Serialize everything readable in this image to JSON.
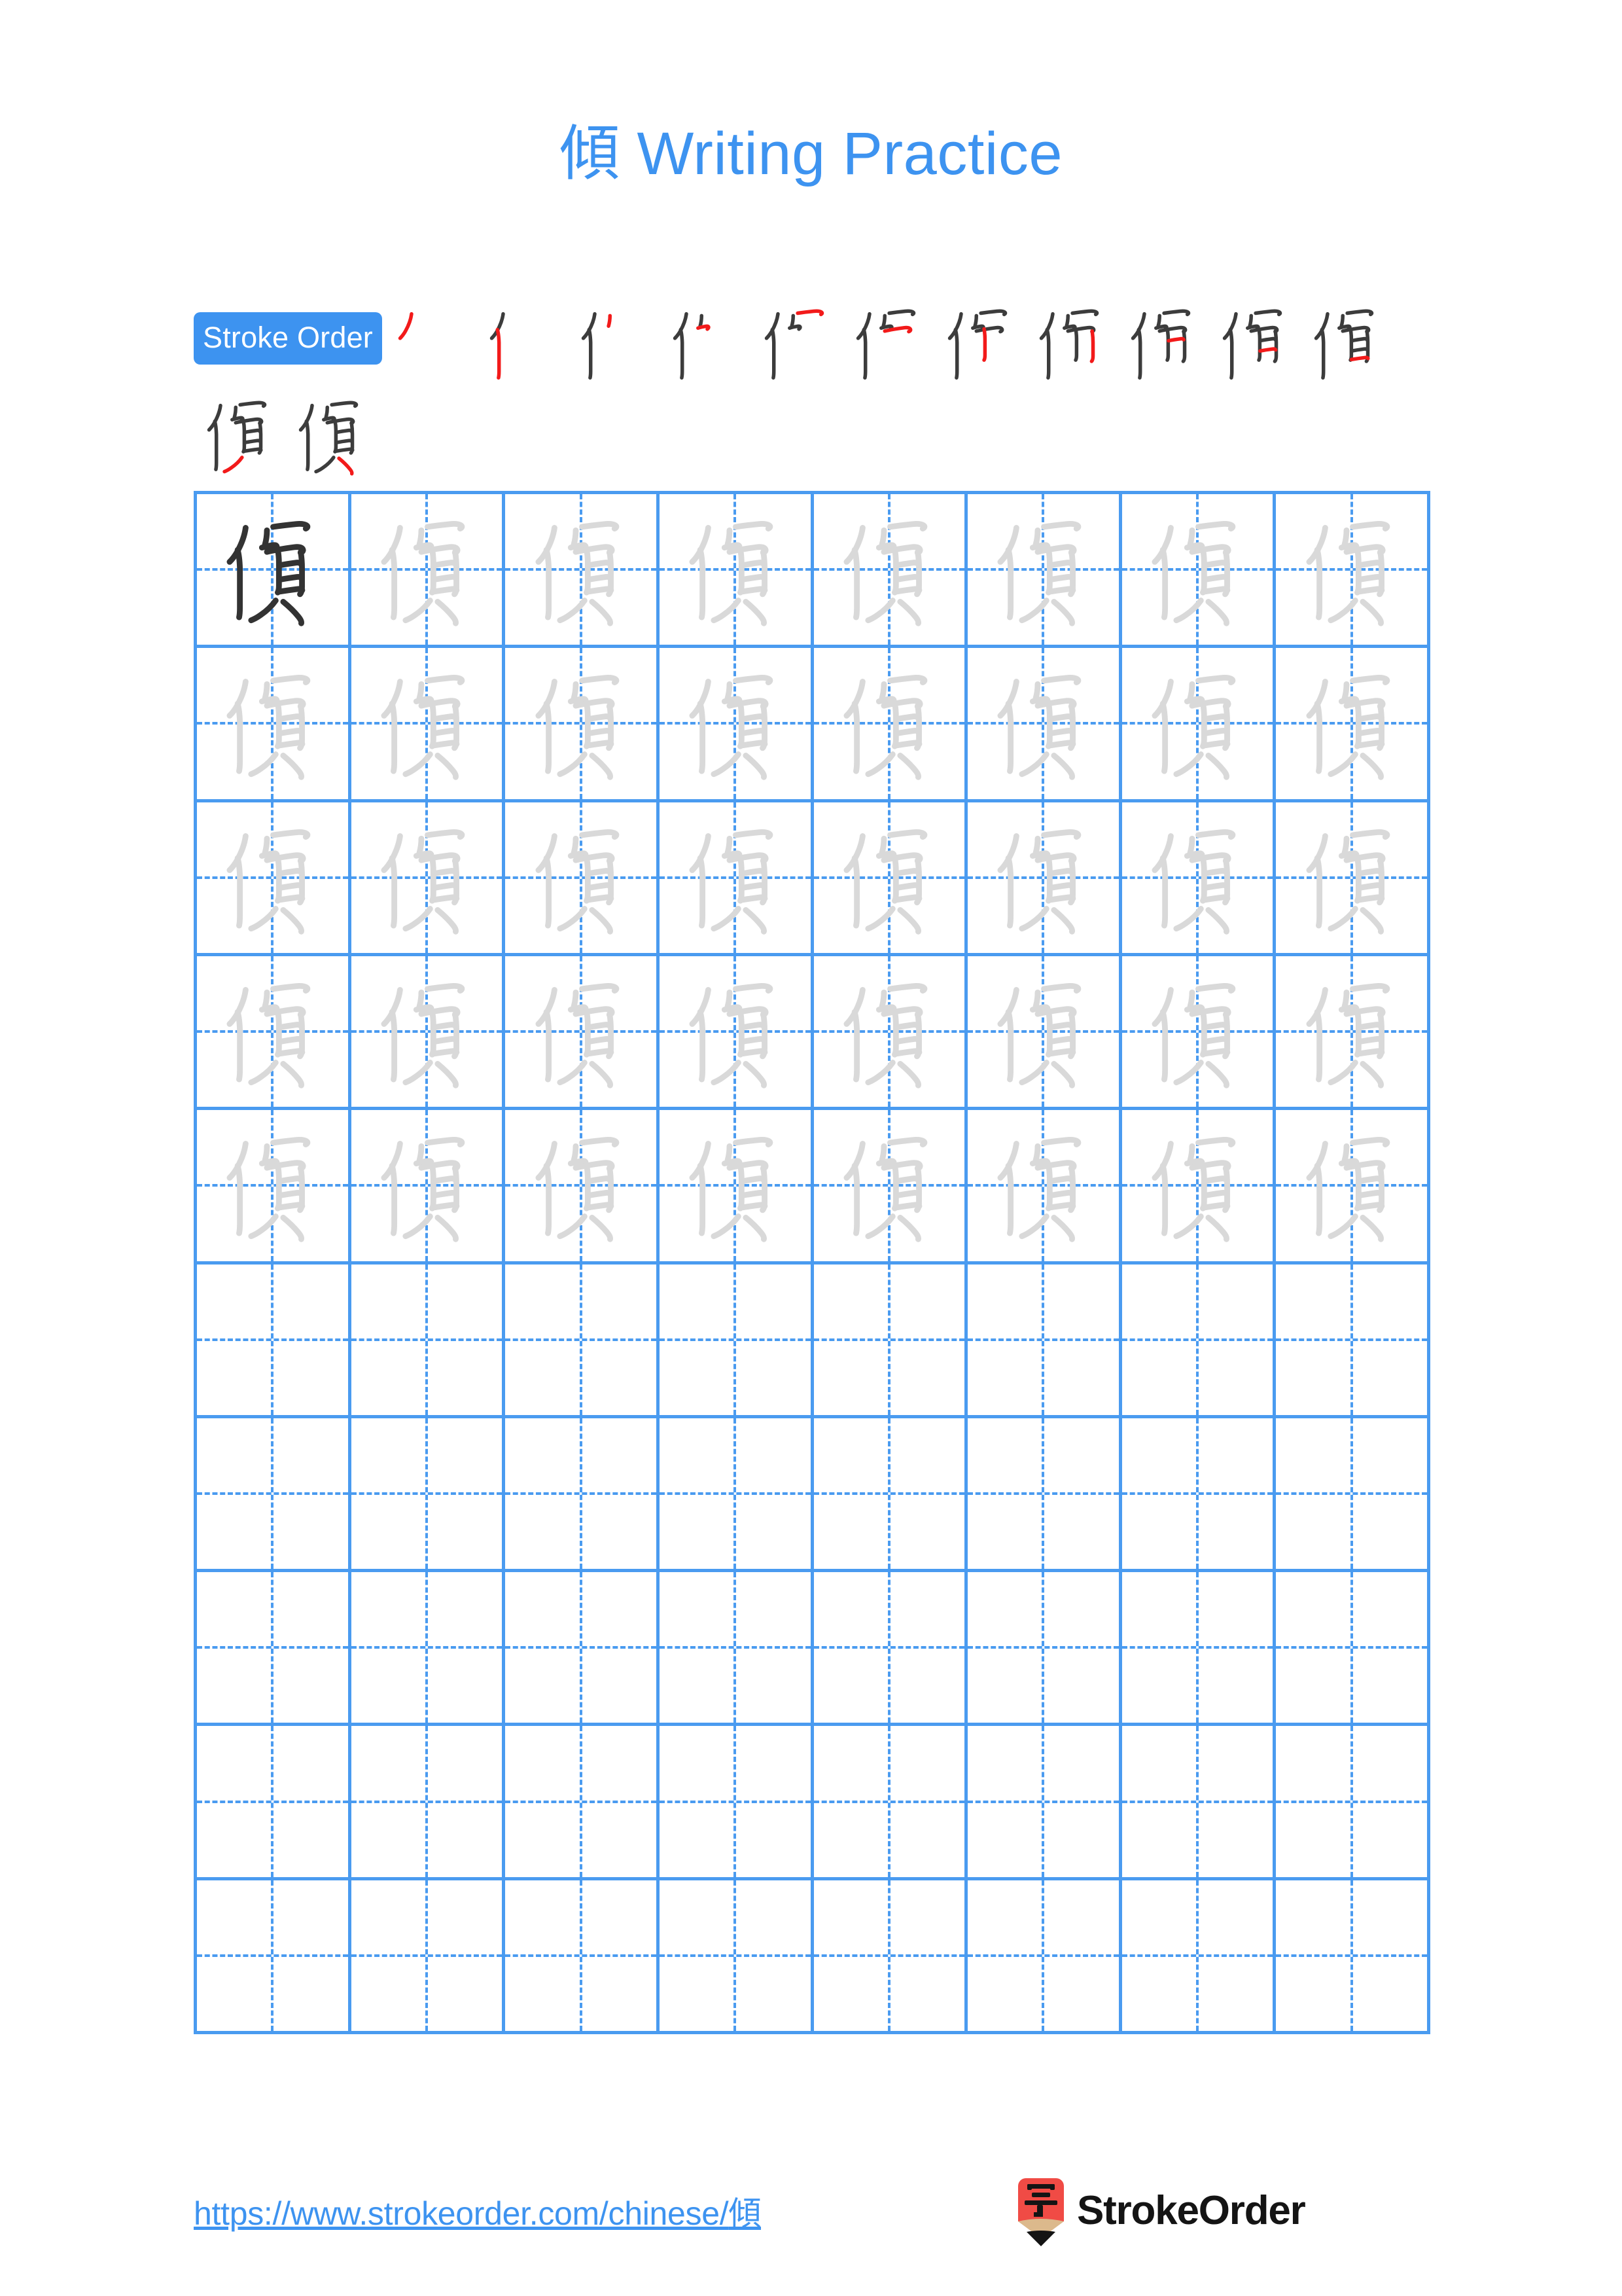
{
  "document": {
    "character": "傾",
    "title": "傾 Writing Practice",
    "title_prefix": "傾",
    "title_suffix": " Writing Practice",
    "page_background": "#ffffff",
    "accent_color": "#3d93f0",
    "grid_line_color": "#4a9bf0",
    "trace_glyph_color": "#d9d9d9",
    "model_glyph_color": "#333333",
    "new_stroke_color": "#f21a1a",
    "prior_stroke_color": "#3c3c3c"
  },
  "stroke_order": {
    "badge_label": "Stroke Order",
    "total_strokes": 13,
    "steps": [
      {
        "index": 1,
        "new_stroke_count": 1,
        "label": "stroke-1"
      },
      {
        "index": 2,
        "new_stroke_count": 1,
        "label": "stroke-2"
      },
      {
        "index": 3,
        "new_stroke_count": 1,
        "label": "stroke-3"
      },
      {
        "index": 4,
        "new_stroke_count": 1,
        "label": "stroke-4"
      },
      {
        "index": 5,
        "new_stroke_count": 1,
        "label": "stroke-5"
      },
      {
        "index": 6,
        "new_stroke_count": 1,
        "label": "stroke-6"
      },
      {
        "index": 7,
        "new_stroke_count": 1,
        "label": "stroke-7"
      },
      {
        "index": 8,
        "new_stroke_count": 1,
        "label": "stroke-8"
      },
      {
        "index": 9,
        "new_stroke_count": 1,
        "label": "stroke-9"
      },
      {
        "index": 10,
        "new_stroke_count": 1,
        "label": "stroke-10"
      },
      {
        "index": 11,
        "new_stroke_count": 1,
        "label": "stroke-11"
      },
      {
        "index": 12,
        "new_stroke_count": 1,
        "label": "stroke-12"
      },
      {
        "index": 13,
        "new_stroke_count": 1,
        "label": "stroke-13"
      }
    ]
  },
  "practice_grid": {
    "columns": 8,
    "rows": 10,
    "traced_rows": 5,
    "blank_rows": 5,
    "model_cell_index": 0,
    "glyph": "傾"
  },
  "footer": {
    "url": "https://www.strokeorder.com/chinese/傾",
    "url_prefix": "https://www.strokeorder.com/chinese/",
    "url_character": "傾",
    "brand_name": "StrokeOrder",
    "logo_character": "字",
    "logo_body_color": "#f04b45",
    "logo_wood_color": "#dcb98c",
    "logo_tip_color": "#141414"
  }
}
